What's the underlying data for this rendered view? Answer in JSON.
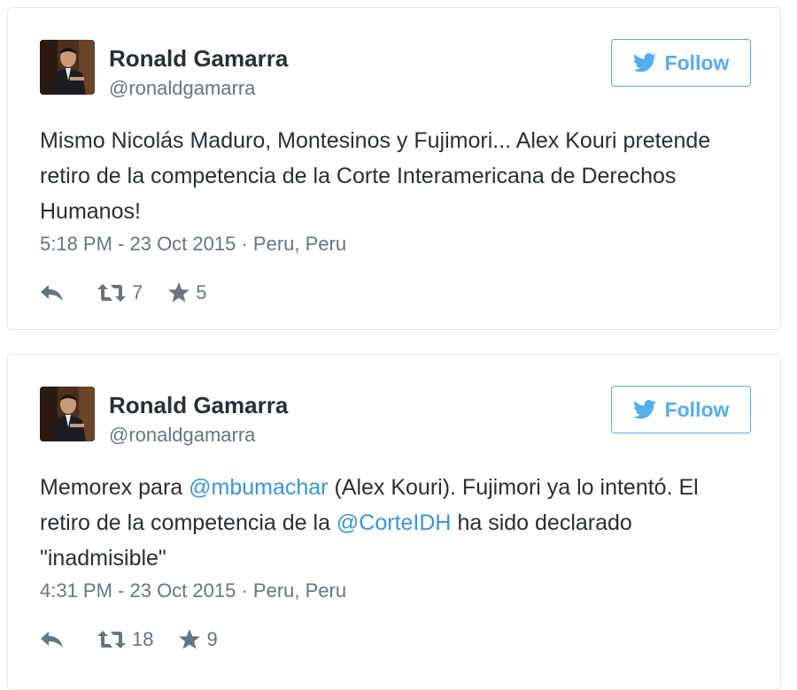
{
  "tweets": [
    {
      "user": {
        "name": "Ronald Gamarra",
        "handle": "@ronaldgamarra"
      },
      "follow_label": "Follow",
      "text_parts": [
        {
          "text": "Mismo Nicolás Maduro, Montesinos y Fujimori... Alex Kouri pretende retiro de la competencia de la Corte Interamericana de Derechos Humanos!",
          "mention": false
        }
      ],
      "time": "5:18 PM - 23 Oct 2015",
      "separator": "·",
      "location": "Peru, Peru",
      "retweets": "7",
      "favorites": "5"
    },
    {
      "user": {
        "name": "Ronald Gamarra",
        "handle": "@ronaldgamarra"
      },
      "follow_label": "Follow",
      "text_parts": [
        {
          "text": "Memorex para ",
          "mention": false
        },
        {
          "text": "@mbumachar",
          "mention": true
        },
        {
          "text": " (Alex  Kouri). Fujimori ya lo intentó. El retiro de la competencia de la ",
          "mention": false
        },
        {
          "text": "@CorteIDH",
          "mention": true
        },
        {
          "text": " ha sido declarado \"inadmisible\"",
          "mention": false
        }
      ],
      "time": "4:31 PM - 23 Oct 2015",
      "separator": "·",
      "location": "Peru, Peru",
      "retweets": "18",
      "favorites": "9"
    }
  ],
  "colors": {
    "accent": "#55acee",
    "link": "#3b94d9",
    "text": "#292f33",
    "muted": "#66757f",
    "border": "#e1e8ed"
  },
  "icons": {
    "follow": "twitter-bird-icon",
    "reply": "reply-icon",
    "retweet": "retweet-icon",
    "favorite": "star-icon"
  }
}
